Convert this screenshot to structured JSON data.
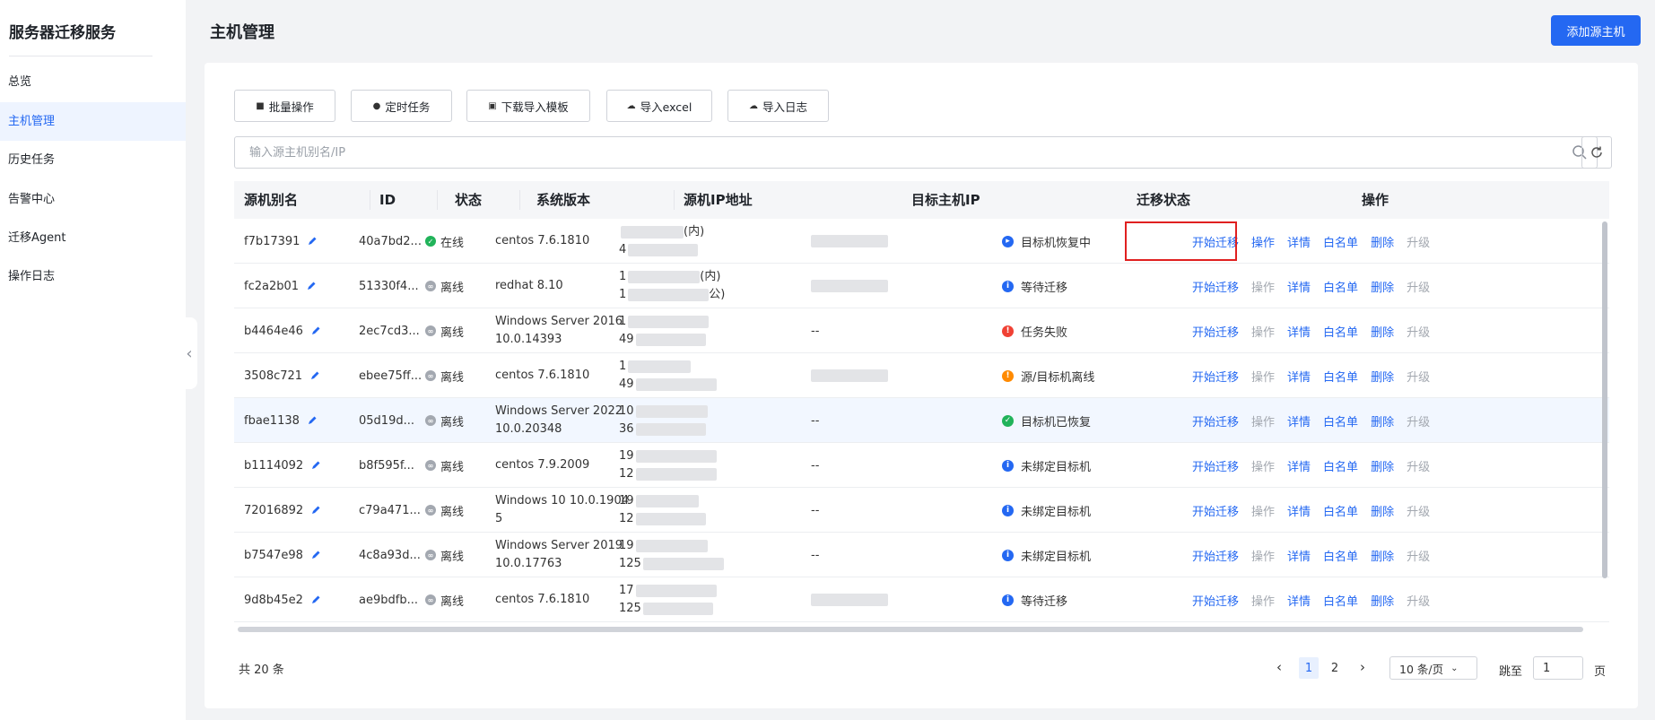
{
  "sidebar": {
    "title": "服务器迁移服务",
    "items": [
      {
        "label": "总览",
        "active": false
      },
      {
        "label": "主机管理",
        "active": true
      },
      {
        "label": "历史任务",
        "active": false
      },
      {
        "label": "告警中心",
        "active": false
      },
      {
        "label": "迁移Agent",
        "active": false
      },
      {
        "label": "操作日志",
        "active": false
      }
    ]
  },
  "header": {
    "title": "主机管理",
    "add_button": "添加源主机"
  },
  "toolbar": {
    "batch": "批量操作",
    "scheduled": "定时任务",
    "download_template": "下载导入模板",
    "import_excel": "导入excel",
    "import_log": "导入日志"
  },
  "search": {
    "placeholder": "输入源主机别名/IP",
    "value": ""
  },
  "table": {
    "headers": [
      "源机别名",
      "ID",
      "状态",
      "系统版本",
      "源机IP地址",
      "目标主机IP",
      "迁移状态",
      "操作"
    ],
    "rows": [
      {
        "alias": "f7b17391",
        "id": "40a7bd2...",
        "status": "在线",
        "online": true,
        "os": [
          "centos 7.6.1810"
        ],
        "ip1": "",
        "ip1_suffix": "(内)",
        "ip2": "4",
        "ip2_suffix": "",
        "target": true,
        "migration": "目标机恢复中",
        "mig_color": "#2468f2",
        "mig_glyph": "▸"
      },
      {
        "alias": "fc2a2b01",
        "id": "51330f4...",
        "status": "离线",
        "online": false,
        "os": [
          "redhat 8.10"
        ],
        "ip1": "1",
        "ip1_suffix": "(内)",
        "ip2": "1",
        "ip2_suffix": "公)",
        "target": true,
        "migration": "等待迁移",
        "mig_color": "#2468f2",
        "mig_glyph": "i"
      },
      {
        "alias": "b4464e46",
        "id": "2ec7cd3...",
        "status": "离线",
        "online": false,
        "os": [
          "Windows Server 2016",
          "10.0.14393"
        ],
        "ip1": "1",
        "ip1_suffix": "",
        "ip2": "49",
        "ip2_suffix": "",
        "target": false,
        "target_text": "--",
        "migration": "任务失败",
        "mig_color": "#f04134",
        "mig_glyph": "!"
      },
      {
        "alias": "3508c721",
        "id": "ebee75ff...",
        "status": "离线",
        "online": false,
        "os": [
          "centos 7.6.1810"
        ],
        "ip1": "1",
        "ip1_suffix": "",
        "ip2": "49",
        "ip2_suffix": "",
        "target": true,
        "migration": "源/目标机离线",
        "mig_color": "#ff8a00",
        "mig_glyph": "!"
      },
      {
        "alias": "fbae1138",
        "id": "05d19d...",
        "status": "离线",
        "online": false,
        "os": [
          "Windows Server 2022",
          "10.0.20348"
        ],
        "ip1": "10",
        "ip1_suffix": "",
        "ip2": "36",
        "ip2_suffix": "",
        "target": false,
        "target_text": "--",
        "migration": "目标机已恢复",
        "mig_color": "#21b35a",
        "mig_glyph": "✓"
      },
      {
        "alias": "b1114092",
        "id": "b8f595f...",
        "status": "离线",
        "online": false,
        "os": [
          "centos 7.9.2009"
        ],
        "ip1": "19",
        "ip1_suffix": "",
        "ip2": "12",
        "ip2_suffix": "",
        "target": false,
        "target_text": "--",
        "migration": "未绑定目标机",
        "mig_color": "#2468f2",
        "mig_glyph": "i"
      },
      {
        "alias": "72016892",
        "id": "c79a471...",
        "status": "离线",
        "online": false,
        "os": [
          "Windows 10 10.0.1904",
          "5"
        ],
        "ip1": "19",
        "ip1_suffix": "",
        "ip2": "12",
        "ip2_suffix": "",
        "target": false,
        "target_text": "--",
        "migration": "未绑定目标机",
        "mig_color": "#2468f2",
        "mig_glyph": "i"
      },
      {
        "alias": "b7547e98",
        "id": "4c8a93d...",
        "status": "离线",
        "online": false,
        "os": [
          "Windows Server 2019",
          "10.0.17763"
        ],
        "ip1": "19",
        "ip1_suffix": "",
        "ip2": "125",
        "ip2_suffix": "",
        "target": false,
        "target_text": "--",
        "migration": "未绑定目标机",
        "mig_color": "#2468f2",
        "mig_glyph": "i"
      },
      {
        "alias": "9d8b45e2",
        "id": "ae9bdfb...",
        "status": "离线",
        "online": false,
        "os": [
          "centos 7.6.1810"
        ],
        "ip1": "17",
        "ip1_suffix": "",
        "ip2": "125",
        "ip2_suffix": "",
        "target": true,
        "migration": "等待迁移",
        "mig_color": "#2468f2",
        "mig_glyph": "i"
      }
    ],
    "row_actions": [
      {
        "label": "开始迁移",
        "enabled": true
      },
      {
        "label": "操作",
        "enabled": false
      },
      {
        "label": "详情",
        "enabled": true
      },
      {
        "label": "白名单",
        "enabled": true
      },
      {
        "label": "删除",
        "enabled": true
      },
      {
        "label": "升级",
        "enabled": false
      }
    ],
    "first_row_operate_enabled": true
  },
  "pagination": {
    "total": "共 20 条",
    "pages": [
      "1",
      "2"
    ],
    "current": "1",
    "page_size": "10 条/页",
    "jump_label": "跳至",
    "jump_value": "1",
    "page_unit": "页"
  },
  "colors": {
    "primary": "#2468f2",
    "error": "#f04134",
    "warning": "#ff8a00",
    "success": "#21b35a",
    "highlight_border": "#e02020"
  }
}
